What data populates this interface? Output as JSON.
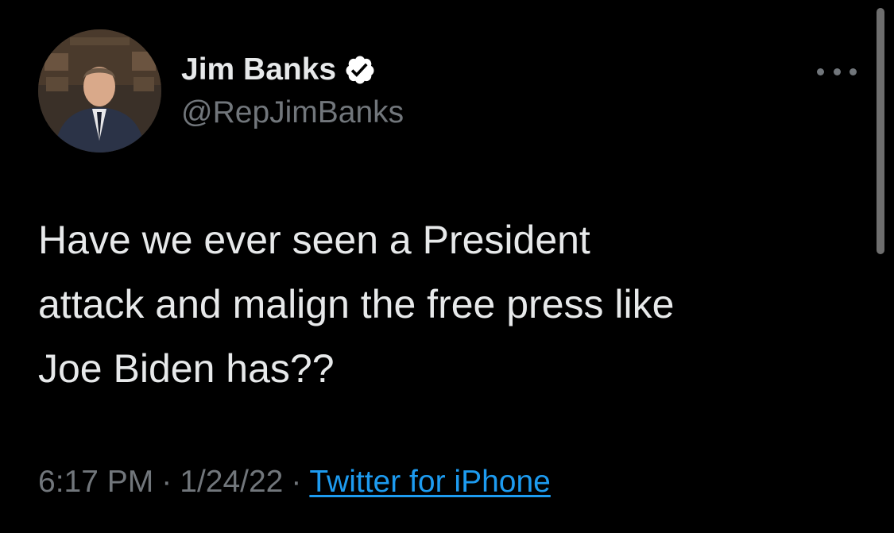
{
  "author": {
    "display_name": "Jim Banks",
    "handle": "@RepJimBanks",
    "verified": true
  },
  "tweet": {
    "text": "Have we ever seen a President\nattack and malign the free press like\nJoe Biden has??",
    "time": "6:17 PM",
    "date": "1/24/22",
    "separator": "·",
    "source": "Twitter for iPhone"
  },
  "icons": {
    "verified_badge": "verified-badge-icon",
    "more": "more-options-icon"
  },
  "colors": {
    "background": "#000000",
    "primary_text": "#e7e9ea",
    "secondary_text": "#71767b",
    "link": "#1d9bf0"
  }
}
